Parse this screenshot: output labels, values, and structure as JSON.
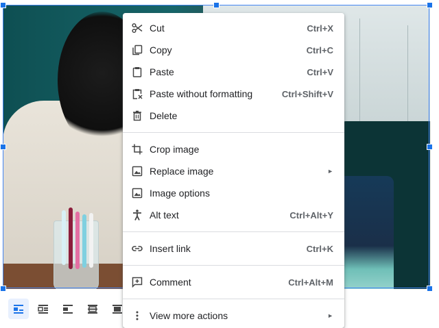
{
  "context_menu": {
    "groups": [
      [
        {
          "label": "Cut",
          "shortcut": "Ctrl+X",
          "icon": "scissors-icon"
        },
        {
          "label": "Copy",
          "shortcut": "Ctrl+C",
          "icon": "copy-icon"
        },
        {
          "label": "Paste",
          "shortcut": "Ctrl+V",
          "icon": "clipboard-icon"
        },
        {
          "label": "Paste without formatting",
          "shortcut": "Ctrl+Shift+V",
          "icon": "clipboard-plain-icon"
        },
        {
          "label": "Delete",
          "shortcut": "",
          "icon": "trash-icon"
        }
      ],
      [
        {
          "label": "Crop image",
          "shortcut": "",
          "icon": "crop-icon"
        },
        {
          "label": "Replace image",
          "shortcut": "",
          "icon": "image-icon",
          "submenu": true
        },
        {
          "label": "Image options",
          "shortcut": "",
          "icon": "image-icon"
        },
        {
          "label": "Alt text",
          "shortcut": "Ctrl+Alt+Y",
          "icon": "accessibility-icon"
        }
      ],
      [
        {
          "label": "Insert link",
          "shortcut": "Ctrl+K",
          "icon": "link-icon"
        }
      ],
      [
        {
          "label": "Comment",
          "shortcut": "Ctrl+Alt+M",
          "icon": "comment-add-icon"
        }
      ],
      [
        {
          "label": "View more actions",
          "shortcut": "",
          "icon": "more-vertical-icon",
          "submenu": true
        }
      ]
    ],
    "submenu_arrow": "►"
  },
  "wrap_toolbar": {
    "buttons": [
      {
        "name": "in-line",
        "icon": "wrap-inline-icon",
        "active": true
      },
      {
        "name": "wrap-text",
        "icon": "wrap-text-icon",
        "active": false
      },
      {
        "name": "break-text",
        "icon": "break-text-icon",
        "active": false
      },
      {
        "name": "behind-text",
        "icon": "behind-text-icon",
        "active": false
      },
      {
        "name": "in-front-of-text",
        "icon": "front-text-icon",
        "active": false
      }
    ]
  },
  "colors": {
    "selection": "#1a73e8",
    "menu_text": "#202124",
    "shortcut_text": "#5f6368",
    "active_button_bg": "#e8f0fe"
  }
}
